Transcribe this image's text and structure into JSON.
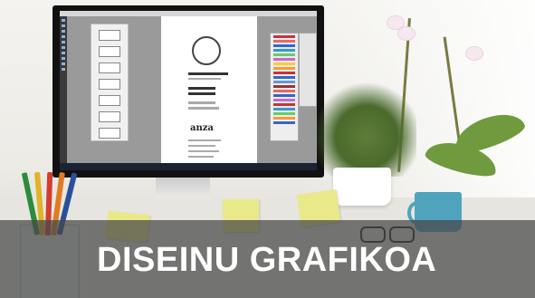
{
  "banner": {
    "caption": "DISEINU GRAFIKOA"
  },
  "screen_document": {
    "logo_text": "anza"
  },
  "colors": {
    "caption_text": "#ffffff",
    "caption_band": "#464646",
    "mug": "#4fa3bd",
    "plant": "#5e7d3a"
  }
}
